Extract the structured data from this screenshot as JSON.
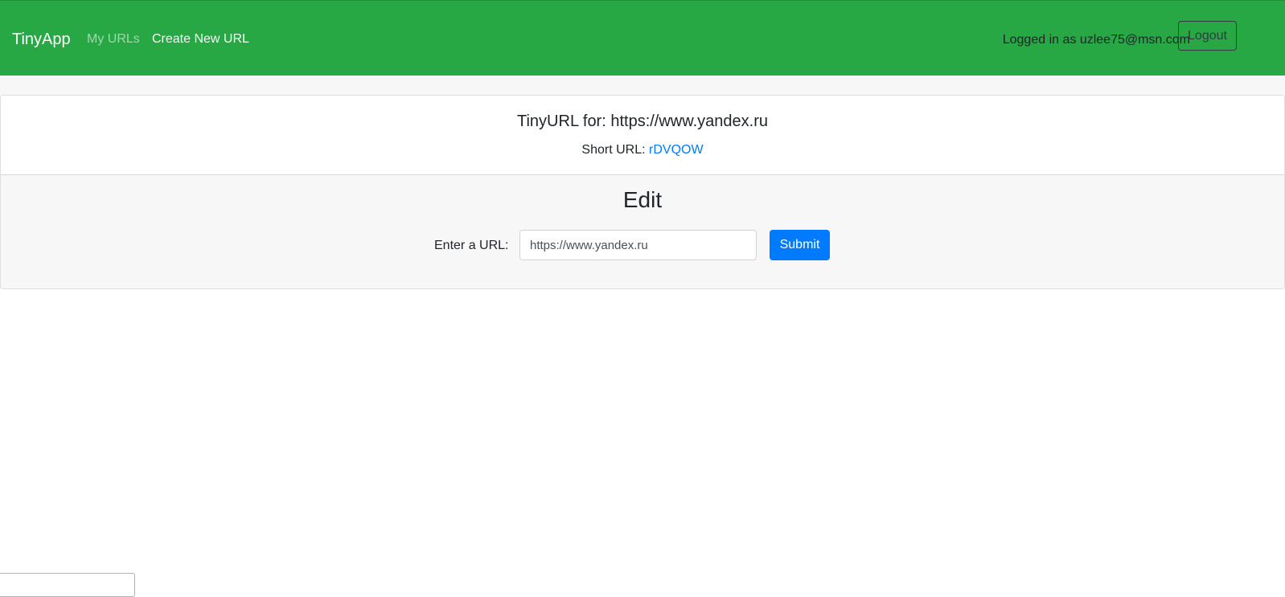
{
  "navbar": {
    "brand": "TinyApp",
    "links": [
      {
        "label": "My URLs"
      },
      {
        "label": "Create New URL"
      }
    ],
    "logged_in_text": "Logged in as uzlee75@msn.com",
    "logout_label": "Logout"
  },
  "url_card": {
    "title": "TinyURL for: https://www.yandex.ru",
    "short_url_label": "Short URL: ",
    "short_url_value": "rDVQOW"
  },
  "edit_form": {
    "heading": "Edit",
    "label": "Enter a URL:",
    "input_value": "https://www.yandex.ru",
    "submit_label": "Submit"
  },
  "colors": {
    "navbar_bg": "#28a745",
    "primary": "#007bff",
    "footer_bg": "#f7f7f7"
  }
}
